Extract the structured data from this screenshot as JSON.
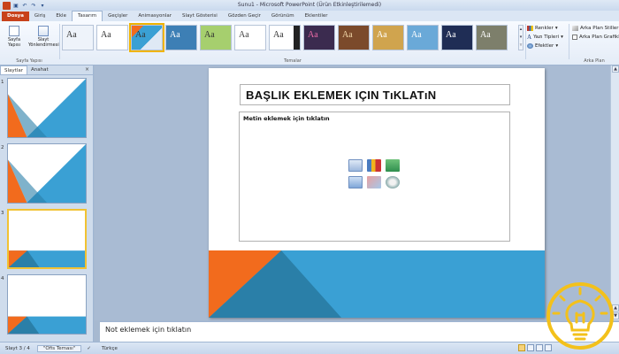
{
  "window": {
    "title": "Sunu1 - Microsoft PowerPoint (Ürün Etkinleştirilemedi)"
  },
  "ribbon": {
    "tabs": [
      "Dosya",
      "Giriş",
      "Ekle",
      "Tasarım",
      "Geçişler",
      "Animasyonlar",
      "Slayt Gösterisi",
      "Gözden Geçir",
      "Görünüm",
      "Eklentiler"
    ],
    "active_tab": "Tasarım",
    "page_setup": {
      "group_label": "Sayfa Yapısı",
      "page_setup_button": "Sayfa Yapısı",
      "orientation_button": "Slayt Yönlendirmesi"
    },
    "themes": {
      "group_label": "Temalar",
      "sample_text": "Aa",
      "count": 13,
      "selected_index": 2
    },
    "theme_options": {
      "colors": "Renkler",
      "fonts": "Yazı Tipleri",
      "effects": "Efektler"
    },
    "background": {
      "group_label": "Arka Plan",
      "styles": "Arka Plan Stilleri",
      "hide_graphics": "Arka Plan Grafikl"
    }
  },
  "thumbnail_pane": {
    "tabs": [
      "Slaytlar",
      "Anahat"
    ],
    "close": "×",
    "slides": [
      {
        "number": "1",
        "selected": false,
        "layout": "title"
      },
      {
        "number": "2",
        "selected": false,
        "layout": "title"
      },
      {
        "number": "3",
        "selected": true,
        "layout": "content"
      },
      {
        "number": "4",
        "selected": false,
        "layout": "content"
      }
    ]
  },
  "slide": {
    "title_placeholder": "BAŞLIK EKLEMEK IÇIN TıKLATıN",
    "content_placeholder": "Metin eklemek için tıklatın",
    "accent_colors": {
      "orange": "#f26b1d",
      "blue": "#3aa0d4",
      "dark_blue": "#2a7fa8"
    }
  },
  "notes": {
    "placeholder": "Not eklemek için tıklatın"
  },
  "status": {
    "slide_indicator": "Slayt 3 / 4",
    "theme_name": "\"Ofis Teması\"",
    "language": "Türkçe"
  }
}
